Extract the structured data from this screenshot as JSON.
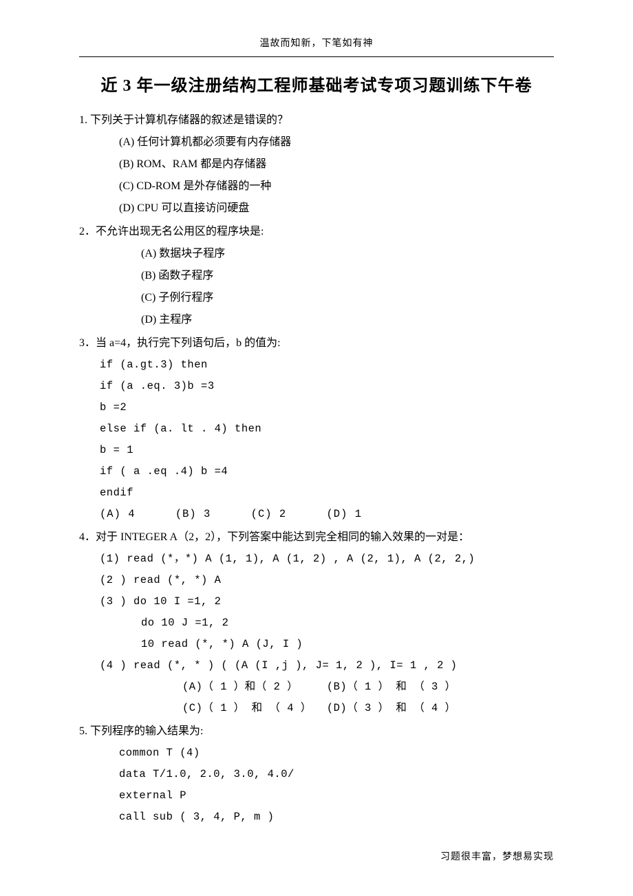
{
  "header": {
    "caption": "温故而知新，下笔如有神"
  },
  "title": "近 3 年一级注册结构工程师基础考试专项习题训练下午卷",
  "q1": {
    "stem": "1. 下列关于计算机存储器的叙述是错误的？",
    "a": "(A)   任何计算机都必须要有内存储器",
    "b": "(B)   ROM、RAM 都是内存储器",
    "c": "(C)   CD-ROM 是外存储器的一种",
    "d": "(D)   CPU 可以直接访问硬盘"
  },
  "q2": {
    "stem": "2．不允许出现无名公用区的程序块是:",
    "a": "(A)   数据块子程序",
    "b": "(B)   函数子程序",
    "c": "(C)   子例行程序",
    "d": "(D)   主程序"
  },
  "q3": {
    "stem": "3．当 a=4，执行完下列语句后，b 的值为:",
    "l1": "if (a.gt.3)  then",
    "l2": "if (a .eq. 3)b =3",
    "l3": "b =2",
    "l4": "else if (a. lt . 4) then",
    "l5": "b = 1",
    "l6": "if ( a .eq .4) b =4",
    "l7": "endif",
    "ans_a": "(A) 4",
    "ans_b": "(B) 3",
    "ans_c": "(C) 2",
    "ans_d": "(D) 1"
  },
  "q4": {
    "stem": "4．对于 INTEGER A（2，2），下列答案中能达到完全相同的输入效果的一对是：",
    "o1": "(1)  read (*，*)   A (1, 1),  A (1, 2) , A (2, 1), A (2, 2,)",
    "o2": "(2 )  read (*, *)  A",
    "o3": "(3 )  do 10 I =1, 2",
    "o3a": "do 10 J =1, 2",
    "o3b": "10  read (*, *) A (J, I )",
    "o4": "(4 )  read  (*, * ) ( (A (I ,j ), J= 1, 2 ), I= 1 , 2 )",
    "ans_a": "(A)（ 1 ）和（ 2 ）",
    "ans_b": "(B)（ 1 ） 和 （ 3 ）",
    "ans_c": "(C)（ 1 ） 和 （ 4 ）",
    "ans_d": "(D)（ 3 ） 和 （ 4 ）"
  },
  "q5": {
    "stem": "5. 下列程序的输入结果为:",
    "l1": "common T (4)",
    "l2": "data  T/1.0,  2.0,  3.0,   4.0/",
    "l3": "external P",
    "l4": "call sub ( 3, 4, P, m )"
  },
  "footer": "习题很丰富，梦想易实现"
}
